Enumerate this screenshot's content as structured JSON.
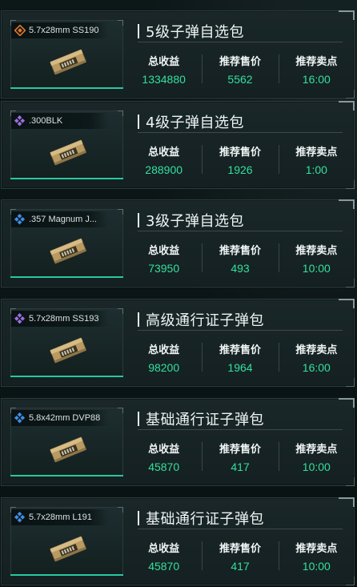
{
  "labels": {
    "income": "总收益",
    "price": "推荐售价",
    "sell_time": "推荐卖点"
  },
  "colors": {
    "value_green": "#33e09e",
    "rarity_orange": "#e07a2a",
    "rarity_purple": "#9a70e0",
    "rarity_blue": "#3f8fe8",
    "progress_line": "#27c8a0"
  },
  "cards": [
    {
      "title": "5级子弹自选包",
      "ammo_name": "5.7x28mm SS190",
      "rarity_icon": "orange-diamond-icon",
      "rarity_color": "#e07a2a",
      "total_income": "1334880",
      "suggested_price": "5562",
      "suggested_time": "16:00"
    },
    {
      "title": "4级子弹自选包",
      "ammo_name": ".300BLK",
      "rarity_icon": "purple-diamond-icon",
      "rarity_color": "#9a70e0",
      "total_income": "288900",
      "suggested_price": "1926",
      "suggested_time": "1:00"
    },
    {
      "title": "3级子弹自选包",
      "ammo_name": ".357 Magnum J...",
      "rarity_icon": "blue-diamond-icon",
      "rarity_color": "#3f8fe8",
      "total_income": "73950",
      "suggested_price": "493",
      "suggested_time": "10:00"
    },
    {
      "title": "高级通行证子弹包",
      "ammo_name": "5.7x28mm SS193",
      "rarity_icon": "purple-diamond-icon",
      "rarity_color": "#9a70e0",
      "total_income": "98200",
      "suggested_price": "1964",
      "suggested_time": "16:00"
    },
    {
      "title": "基础通行证子弹包",
      "ammo_name": "5.8x42mm DVP88",
      "rarity_icon": "blue-diamond-icon",
      "rarity_color": "#3f8fe8",
      "total_income": "45870",
      "suggested_price": "417",
      "suggested_time": "10:00"
    },
    {
      "title": "基础通行证子弹包",
      "ammo_name": "5.7x28mm L191",
      "rarity_icon": "blue-diamond-icon",
      "rarity_color": "#3f8fe8",
      "total_income": "45870",
      "suggested_price": "417",
      "suggested_time": "10:00"
    }
  ]
}
